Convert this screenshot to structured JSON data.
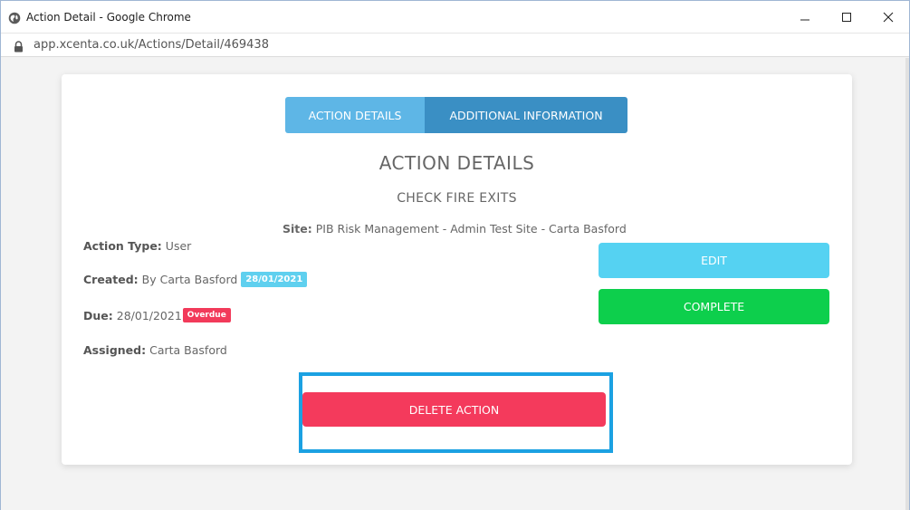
{
  "window": {
    "title": "Action Detail - Google Chrome",
    "url": "app.xcenta.co.uk/Actions/Detail/469438"
  },
  "tabs": [
    {
      "label": "ACTION DETAILS"
    },
    {
      "label": "ADDITIONAL INFORMATION"
    }
  ],
  "detail": {
    "heading": "ACTION DETAILS",
    "action_title": "CHECK FIRE EXITS",
    "site_label": "Site:",
    "site_value": "PIB Risk Management - Admin Test Site - Carta Basford",
    "action_type_label": "Action Type:",
    "action_type_value": "User",
    "created_label": "Created:",
    "created_value": "By Carta Basford",
    "created_date_badge": "28/01/2021",
    "due_label": "Due:",
    "due_value": "28/01/2021",
    "overdue_badge": "Overdue",
    "assigned_label": "Assigned:",
    "assigned_value": "Carta Basford"
  },
  "buttons": {
    "edit": "EDIT",
    "complete": "COMPLETE",
    "delete": "DELETE ACTION"
  },
  "icons": {
    "window_icon": "globe-icon",
    "minimize": "minimize-icon",
    "maximize": "maximize-icon",
    "close": "close-icon",
    "lock": "lock-icon"
  },
  "colors": {
    "tab_active": "#5eb6e6",
    "tab_inactive": "#3a8fc4",
    "edit": "#55d2f2",
    "complete": "#0dcf4c",
    "delete": "#f43a5c",
    "overdue": "#f23a5a",
    "date_badge": "#5fd0ef",
    "highlight": "#1ba1e2"
  }
}
